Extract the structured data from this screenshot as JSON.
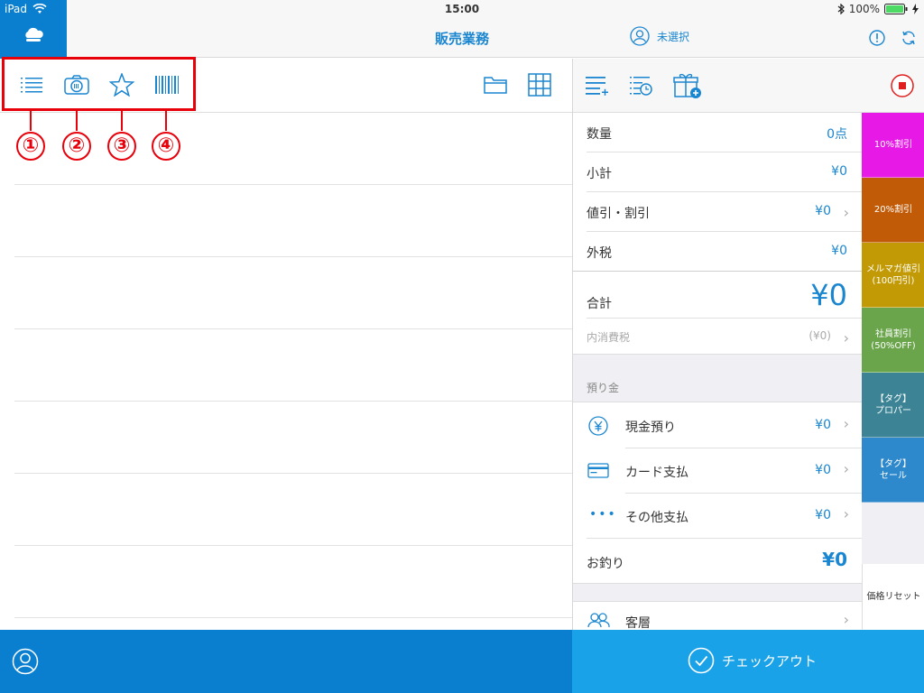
{
  "status": {
    "device": "iPad",
    "time": "15:00",
    "battery": "100%"
  },
  "nav": {
    "title": "販売業務",
    "customer": "未選択"
  },
  "callouts": [
    "①",
    "②",
    "③",
    "④"
  ],
  "summary": {
    "quantity_label": "数量",
    "quantity_value": "0点",
    "subtotal_label": "小計",
    "subtotal_value": "¥0",
    "discount_label": "値引・割引",
    "discount_value": "¥0",
    "tax_label": "外税",
    "tax_value": "¥0",
    "total_label": "合計",
    "total_value": "¥0",
    "inner_tax_label": "内消費税",
    "inner_tax_value": "(¥0)",
    "deposit_header": "預り金",
    "cash_label": "現金預り",
    "cash_value": "¥0",
    "card_label": "カード支払",
    "card_value": "¥0",
    "other_label": "その他支払",
    "other_value": "¥0",
    "change_label": "お釣り",
    "change_value": "¥0",
    "segment_label": "客層"
  },
  "quick_buttons": [
    {
      "line1": "10%割引",
      "line2": "",
      "color": "#e619e6"
    },
    {
      "line1": "20%割引",
      "line2": "",
      "color": "#c25b07"
    },
    {
      "line1": "メルマガ値引",
      "line2": "(100円引)",
      "color": "#c29a05"
    },
    {
      "line1": "社員割引",
      "line2": "(50%OFF)",
      "color": "#6aa54b"
    },
    {
      "line1": "【タグ】",
      "line2": "プロパー",
      "color": "#3c8495"
    },
    {
      "line1": "【タグ】",
      "line2": "セール",
      "color": "#2e88cc"
    }
  ],
  "reset_label": "価格リセット",
  "checkout_label": "チェックアウト",
  "colors": {
    "accent": "#1a86d0",
    "brand": "#0a7fd0",
    "checkout": "#1aa2e8",
    "highlight": "#e8000b",
    "stop": "#e02020"
  }
}
